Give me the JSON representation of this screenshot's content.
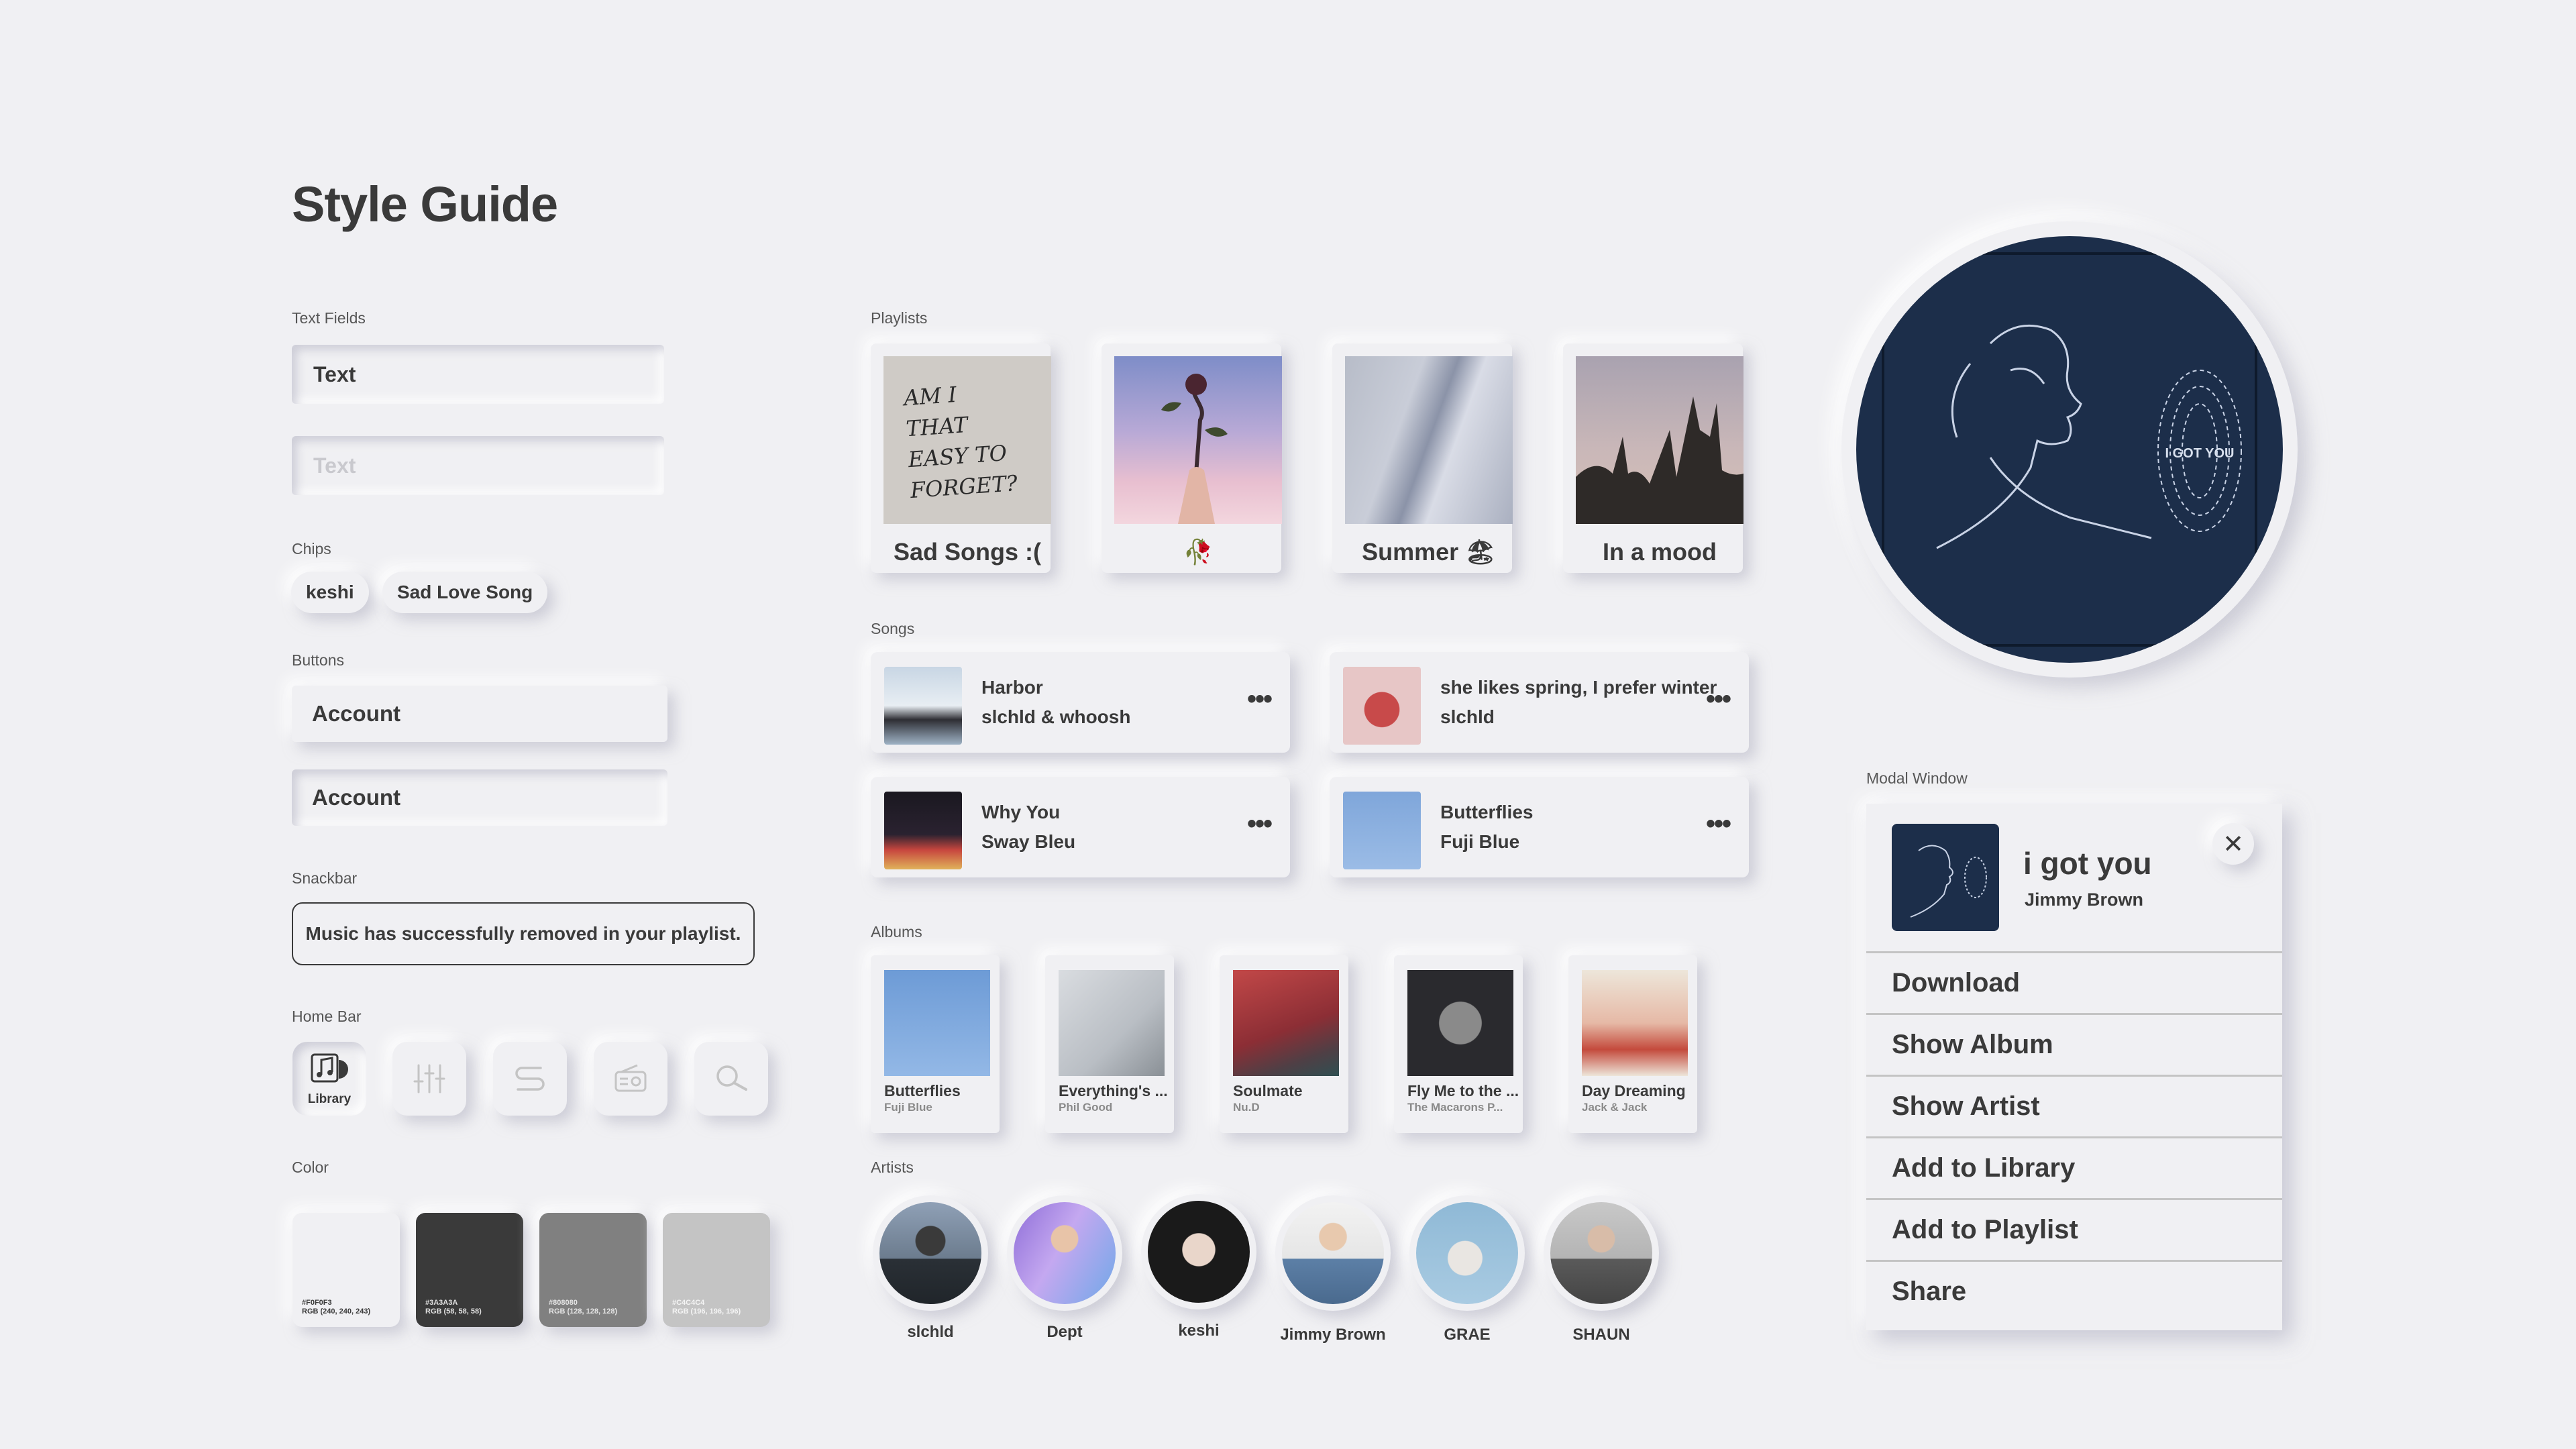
{
  "title": "Style Guide",
  "sections": {
    "text_fields": "Text Fields",
    "chips": "Chips",
    "buttons": "Buttons",
    "snackbar": "Snackbar",
    "home_bar": "Home Bar",
    "color": "Color",
    "playlists": "Playlists",
    "songs": "Songs",
    "albums": "Albums",
    "artists": "Artists",
    "modal": "Modal Window"
  },
  "text_fields": {
    "filled_value": "Text",
    "placeholder": "Text"
  },
  "chips": [
    "keshi",
    "Sad Love Song"
  ],
  "buttons": {
    "raised_label": "Account",
    "pressed_label": "Account"
  },
  "snackbar": "Music has successfully removed in your playlist.",
  "home_bar": {
    "active_label": "Library",
    "icons": [
      "music-note-icon",
      "equalizer-icon",
      "swirl-icon",
      "radio-icon",
      "search-icon"
    ]
  },
  "colors": [
    {
      "hex": "#F0F0F3",
      "label_hex": "#F0F0F3",
      "rgb": "RGB (240, 240, 243)",
      "text": "#3A3A3A"
    },
    {
      "hex": "#3A3A3A",
      "label_hex": "#3A3A3A",
      "rgb": "RGB (58, 58, 58)",
      "text": "#E0E0E0"
    },
    {
      "hex": "#808080",
      "label_hex": "#808080",
      "rgb": "RGB (128, 128, 128)",
      "text": "#E0E0E0"
    },
    {
      "hex": "#C4C4C4",
      "label_hex": "#C4C4C4",
      "rgb": "RGB (196, 196, 196)",
      "text": "#F5F5F5"
    }
  ],
  "playlists": [
    {
      "name": "Sad Songs :(",
      "cover_text": "AM I THAT EASY TO FORGET?"
    },
    {
      "name": "🥀"
    },
    {
      "name": "Summer 🏖"
    },
    {
      "name": "In a mood"
    }
  ],
  "songs": [
    {
      "title": "Harbor",
      "artist": "slchld & whoosh"
    },
    {
      "title": "she likes spring, I prefer winter",
      "artist": "slchld"
    },
    {
      "title": "Why You",
      "artist": "Sway Bleu"
    },
    {
      "title": "Butterflies",
      "artist": "Fuji Blue"
    }
  ],
  "song_more": "•••",
  "albums": [
    {
      "title": "Butterflies",
      "artist": "Fuji Blue"
    },
    {
      "title": "Everything's ...",
      "artist": "Phil Good"
    },
    {
      "title": "Soulmate",
      "artist": "Nu.D"
    },
    {
      "title": "Fly Me to the ...",
      "artist": "The Macarons P..."
    },
    {
      "title": "Day Dreaming",
      "artist": "Jack & Jack"
    }
  ],
  "artists": [
    "slchld",
    "Dept",
    "keshi",
    "Jimmy Brown",
    "GRAE",
    "SHAUN"
  ],
  "hero_art_text": "I GOT YOU",
  "modal": {
    "song_title": "i got you",
    "artist": "Jimmy Brown",
    "close": "✕",
    "items": [
      "Download",
      "Show Album",
      "Show Artist",
      "Add to Library",
      "Add to Playlist",
      "Share"
    ]
  }
}
